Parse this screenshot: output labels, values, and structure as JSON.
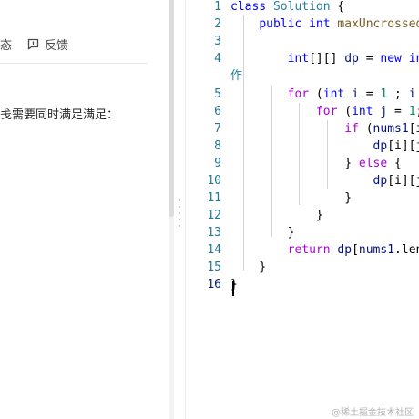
{
  "left_panel": {
    "action_partial": "态",
    "feedback_label": "反馈",
    "body_text": "戋需要同时满足满足："
  },
  "editor": {
    "line_numbers": [
      "1",
      "2",
      "3",
      "4",
      "5",
      "6",
      "7",
      "8",
      "9",
      "10",
      "11",
      "12",
      "13",
      "14",
      "15",
      "16"
    ],
    "active_line": "16",
    "wrapped_fragment": "作",
    "lines": [
      [
        [
          "class",
          "kw"
        ],
        [
          " ",
          ""
        ],
        [
          "Solution",
          "typ"
        ],
        [
          " {",
          ""
        ]
      ],
      [
        [
          "    ",
          ""
        ],
        [
          "public",
          "kw"
        ],
        [
          " ",
          ""
        ],
        [
          "int",
          "kw"
        ],
        [
          " ",
          ""
        ],
        [
          "maxUncrossedLines",
          "fn"
        ]
      ],
      [],
      [
        [
          "        ",
          ""
        ],
        [
          "int",
          "kw"
        ],
        [
          "[][] ",
          ""
        ],
        [
          "dp",
          "var"
        ],
        [
          " = ",
          ""
        ],
        [
          "new",
          "kw"
        ],
        [
          " ",
          ""
        ],
        [
          "int",
          "kw"
        ]
      ],
      [
        [
          "        ",
          ""
        ],
        [
          "for",
          "ctl"
        ],
        [
          " (",
          ""
        ],
        [
          "int",
          "kw"
        ],
        [
          " ",
          ""
        ],
        [
          "i",
          "var"
        ],
        [
          " = ",
          ""
        ],
        [
          "1",
          "num"
        ],
        [
          " ; ",
          ""
        ],
        [
          "i",
          "var"
        ],
        [
          " <",
          ""
        ]
      ],
      [
        [
          "            ",
          ""
        ],
        [
          "for",
          "ctl"
        ],
        [
          " (",
          ""
        ],
        [
          "int",
          "kw"
        ],
        [
          " ",
          ""
        ],
        [
          "j",
          "var"
        ],
        [
          " = ",
          ""
        ],
        [
          "1",
          "num"
        ],
        [
          ";",
          ""
        ]
      ],
      [
        [
          "                ",
          ""
        ],
        [
          "if",
          "ctl"
        ],
        [
          " (",
          ""
        ],
        [
          "nums1",
          "var"
        ],
        [
          "[i-",
          ""
        ]
      ],
      [
        [
          "                    ",
          ""
        ],
        [
          "dp",
          "var"
        ],
        [
          "[i][j]",
          ""
        ]
      ],
      [
        [
          "                ",
          ""
        ],
        [
          "} ",
          ""
        ],
        [
          "else",
          "ctl"
        ],
        [
          " {",
          ""
        ]
      ],
      [
        [
          "                    ",
          ""
        ],
        [
          "dp",
          "var"
        ],
        [
          "[i][j]",
          ""
        ]
      ],
      [
        [
          "                }",
          ""
        ]
      ],
      [
        [
          "            }",
          ""
        ]
      ],
      [
        [
          "        }",
          ""
        ]
      ],
      [
        [
          "        ",
          ""
        ],
        [
          "return",
          "ctl"
        ],
        [
          " ",
          ""
        ],
        [
          "dp",
          "var"
        ],
        [
          "[",
          ""
        ],
        [
          "nums1",
          "var"
        ],
        [
          ".length",
          ""
        ]
      ],
      [
        [
          "    }",
          ""
        ]
      ],
      [
        [
          "}",
          ""
        ]
      ]
    ]
  },
  "watermark": "@稀土掘金技术社区",
  "colors": {
    "keyword": "#0000ff",
    "control": "#af00db",
    "type": "#267f99",
    "function": "#795e26",
    "variable": "#001080",
    "number": "#098658",
    "line_number": "#237893"
  }
}
